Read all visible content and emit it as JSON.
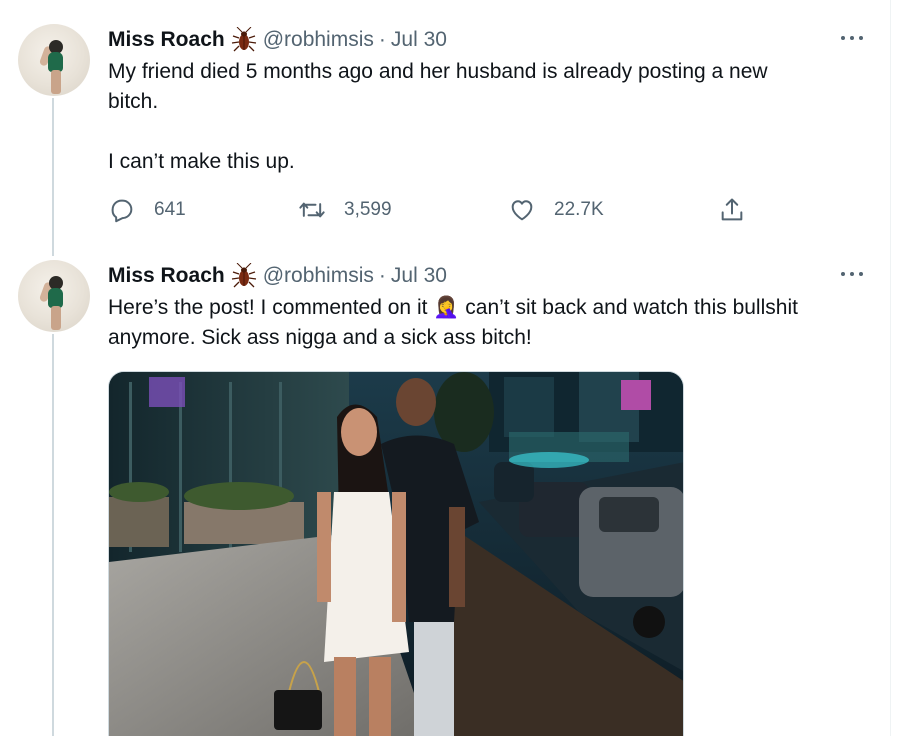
{
  "tweets": [
    {
      "author_name": "Miss Roach",
      "author_handle": "@robhimsis",
      "separator": "·",
      "date": "Jul 30",
      "text": "My friend died 5 months ago and her husband is already posting a new\nbitch.\n\nI can’t make this up.",
      "stats": {
        "replies": "641",
        "retweets": "3,599",
        "likes": "22.7K"
      }
    },
    {
      "author_name": "Miss Roach",
      "author_handle": "@robhimsis",
      "separator": "·",
      "date": "Jul 30",
      "text_before_emoji": "Here’s the post! I commented on it ",
      "emoji": "🤦‍♀️",
      "text_after_emoji": " can’t sit back and watch this bullshit\nanymore. Sick ass nigga and a sick ass bitch!"
    }
  ],
  "icons": {
    "verified_emoji": "cockroach-icon",
    "more": "more-options-icon",
    "reply": "reply-icon",
    "retweet": "retweet-icon",
    "like": "heart-icon",
    "share": "share-icon"
  },
  "colors": {
    "text_primary": "#0f1419",
    "text_secondary": "#536471",
    "thread_line": "#cfd9de"
  }
}
